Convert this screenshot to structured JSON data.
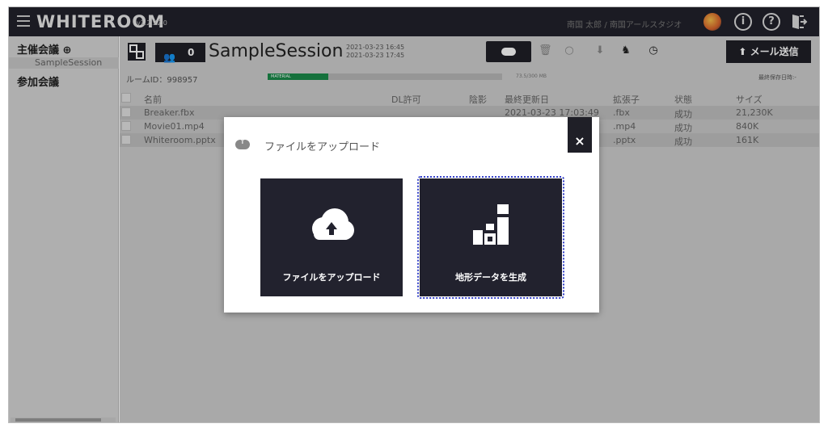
{
  "app": {
    "logo": "WHITEROOM",
    "version": "v1.2.22.0",
    "user": "南国 太郎 / 南国アールスタジオ",
    "info_glyph": "i",
    "help_glyph": "?"
  },
  "sidebar": {
    "host_label": "主催会議 ⊕",
    "session_item": "SampleSession",
    "join_label": "参加会議"
  },
  "session": {
    "member_count": "0",
    "title": "SampleSession",
    "created": "2021-03-23 16:45",
    "updated": "2021-03-23 17:45",
    "mail_button": "⬆ メール送信",
    "room_id": "ルームID：998957",
    "storage_label": "MATERIAL",
    "storage_fraction": 0.26,
    "storage_text": "73.5/300 MB",
    "last_saved": "最終保存日時:-"
  },
  "table": {
    "headers": {
      "name": "名前",
      "dl": "DL許可",
      "shadow": "陰影",
      "modified": "最終更新日",
      "ext": "拡張子",
      "status": "状態",
      "size": "サイズ"
    },
    "rows": [
      {
        "name": "Breaker.fbx",
        "modified": "2021-03-23 17:03:49",
        "ext": ".fbx",
        "status": "成功",
        "size": "21,230K"
      },
      {
        "name": "Movie01.mp4",
        "modified": "",
        "ext": ".mp4",
        "status": "成功",
        "size": "840K"
      },
      {
        "name": "Whiteroom.pptx",
        "modified": "",
        "ext": ".pptx",
        "status": "成功",
        "size": "161K"
      }
    ]
  },
  "modal": {
    "title": "ファイルをアップロード",
    "close": "×",
    "tile_upload": "ファイルをアップロード",
    "tile_terrain": "地形データを生成"
  },
  "colors": {
    "topbar": "#22222b",
    "tile": "#22222e",
    "storage_fill": "#1a8a4a",
    "focus": "#3340c8"
  }
}
